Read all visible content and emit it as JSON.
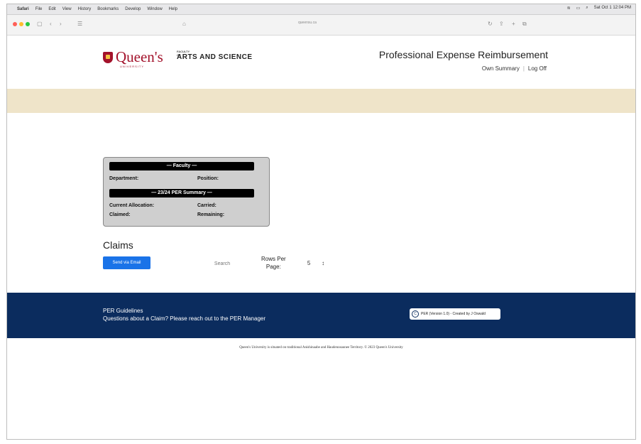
{
  "menubar": {
    "app": "Safari",
    "items": [
      "File",
      "Edit",
      "View",
      "History",
      "Bookmarks",
      "Develop",
      "Window",
      "Help"
    ],
    "clock": "Sat Oct 1 12:04 PM"
  },
  "browser": {
    "url": "queensu.ca"
  },
  "header": {
    "brand": "Queen's",
    "university": "UNIVERSITY",
    "faculty_small": "FACULTY OF",
    "faculty_big": "ARTS AND SCIENCE",
    "title": "Professional Expense Reimbursement",
    "nav": {
      "own_summary": "Own Summary",
      "separator": "|",
      "log_off": "Log Off"
    }
  },
  "summary_card": {
    "faculty_header": "— Faculty —",
    "department_label": "Department:",
    "position_label": "Position:",
    "per_header": "— 23/24 PER Summary —",
    "current_allocation_label": "Current Allocation:",
    "carried_label": "Carried:",
    "claimed_label": "Claimed:",
    "remaining_label": "Remaining:"
  },
  "claims": {
    "title": "Claims",
    "send_button": "Send via Email",
    "search_placeholder": "Search",
    "rows_per_page_label_1": "Rows Per",
    "rows_per_page_label_2": "Page:",
    "rows_per_page_value": "5",
    "select_arrow": "↕"
  },
  "footer": {
    "guidelines": "PER Guidelines",
    "questions": "Questions about a Claim? Please reach out to the PER Manager",
    "badge": "PER (Version 1.0) - Created by J Oswald",
    "land_ack": "Queen's University is situated on traditional Anishinaabe and Haudenosaunee Territory. © 2023 Queen's University"
  },
  "colors": {
    "brand_red": "#a3122b",
    "banner": "#efe4c9",
    "footer_navy": "#0b2c5e",
    "button_blue": "#1a73e8"
  }
}
